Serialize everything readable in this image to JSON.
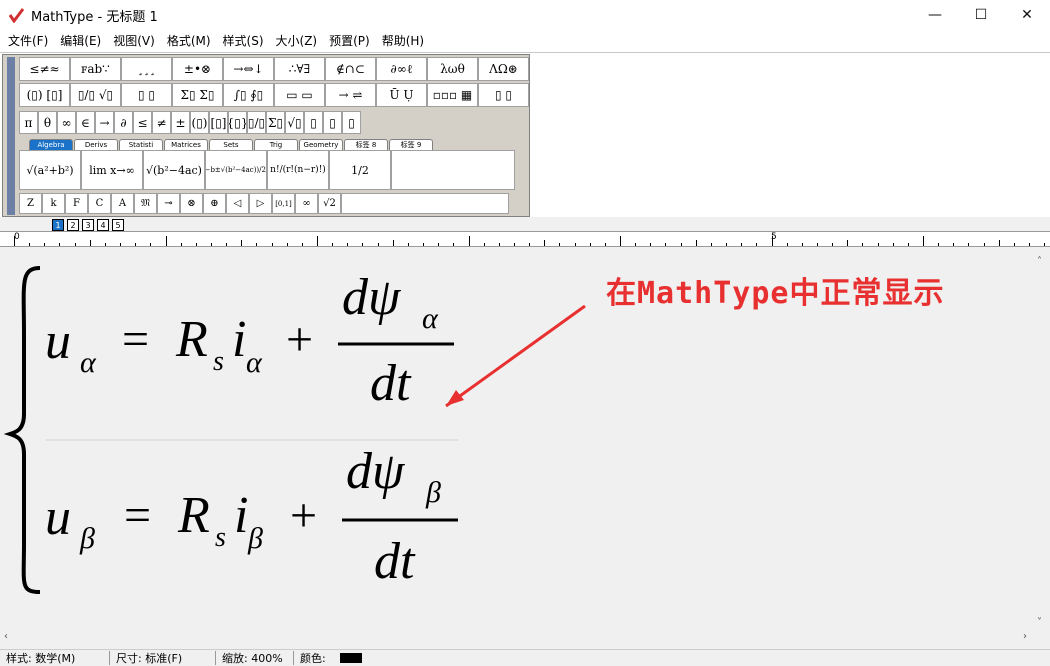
{
  "window": {
    "title": "MathType - 无标题 1",
    "minimize": "—",
    "maximize": "☐",
    "close": "✕"
  },
  "menu": [
    "文件(F)",
    "编辑(E)",
    "视图(V)",
    "格式(M)",
    "样式(S)",
    "大小(Z)",
    "预置(P)",
    "帮助(H)"
  ],
  "palette": {
    "row1": [
      "≤≠≈",
      "ꜰab∵",
      "¸¸¸",
      "±•⊗",
      "→⇔↓",
      "∴∀∃",
      "∉∩⊂",
      "∂∞ℓ",
      "λωθ",
      "ΛΩ⊛"
    ],
    "row2": [
      "(▯) [▯]",
      "▯/▯ √▯",
      "▯ ▯",
      "Σ▯ Σ▯",
      "∫▯ ∮▯",
      "▭ ▭",
      "→ ⇌",
      "Ū Ụ",
      "▫▫▫ ▦",
      "▯ ▯"
    ],
    "row3": [
      "π",
      "θ",
      "∞",
      "∈",
      "→",
      "∂",
      "≤",
      "≠",
      "±",
      "(▯)",
      "[▯]",
      "{▯}",
      "▯/▯",
      "Σ▯",
      "√▯",
      "▯",
      "▯",
      "▯"
    ],
    "tabs": [
      "Algebra",
      "Derivs",
      "Statisti",
      "Matrices",
      "Sets",
      "Trig",
      "Geometry",
      "标签 8",
      "标签 9"
    ],
    "templates": [
      "√(a²+b²)",
      "lim x→∞",
      "√(b²−4ac)",
      "(−b±√(b²−4ac))/2a",
      "n!/(r!(n−r)!)",
      "1/2"
    ],
    "row5": [
      "Z",
      "k",
      "F",
      "C",
      "A",
      "𝔐",
      "⊸",
      "⊗",
      "⊕",
      "◁",
      "▷",
      "[0,1]",
      "∞",
      "√2"
    ],
    "sizes": [
      "1",
      "2",
      "3",
      "4",
      "5"
    ]
  },
  "ruler": {
    "label0": "0",
    "label5": "5"
  },
  "equation": {
    "row1": {
      "lhs": "u",
      "lhs_sub": "α",
      "eq": "=",
      "R": "R",
      "R_sub": "s",
      "i": "i",
      "i_sub": "α",
      "plus": "+",
      "num": "dψ",
      "num_sub": "α",
      "den": "dt"
    },
    "row2": {
      "lhs": "u",
      "lhs_sub": "β",
      "eq": "=",
      "R": "R",
      "R_sub": "s",
      "i": "i",
      "i_sub": "β",
      "plus": "+",
      "num": "dψ",
      "num_sub": "β",
      "den": "dt"
    }
  },
  "annotation": "在MathType中正常显示",
  "status": {
    "style": "样式: 数学(M)",
    "size": "尺寸: 标准(F)",
    "zoom": "缩放: 400%",
    "color": "颜色:"
  },
  "colors": {
    "annotation": "#e83030",
    "accent": "#1a73c8"
  }
}
